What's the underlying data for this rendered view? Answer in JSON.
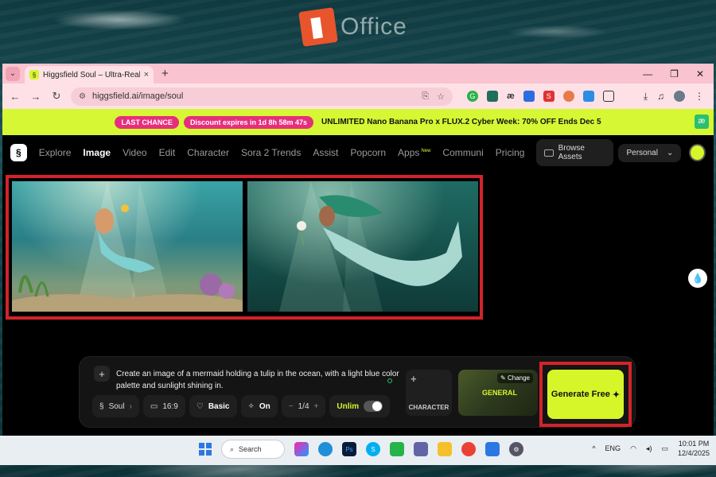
{
  "watermark": {
    "text": "Office"
  },
  "browser": {
    "tab_title": "Higgsfield Soul – Ultra-Realistic",
    "url": "higgsfield.ai/image/soul"
  },
  "promo": {
    "pill1": "LAST CHANCE",
    "pill2": "Discount expires in 1d 8h 58m 47s",
    "text": "UNLIMITED Nano Banana Pro x FLUX.2 Cyber Week: 70% OFF Ends Dec 5"
  },
  "nav": {
    "items": [
      "Explore",
      "Image",
      "Video",
      "Edit",
      "Character",
      "Sora 2 Trends",
      "Assist",
      "Popcorn",
      "Apps",
      "Communi",
      "Pricing"
    ],
    "apps_badge": "New",
    "browse_assets": "Browse Assets",
    "workspace": "Personal"
  },
  "composer": {
    "prompt": "Create an image of a mermaid holding a tulip in the ocean, with a light blue color palette and sunlight shining in.",
    "model": "Soul",
    "aspect": "16:9",
    "quality": "Basic",
    "enhance": "On",
    "count": "1/4",
    "unlim": "Unlim",
    "character_label": "CHARACTER",
    "style_change": "Change",
    "style_label": "GENERAL",
    "generate": "Generate Free"
  },
  "taskbar": {
    "search": "Search",
    "lang": "ENG",
    "time": "10:01 PM",
    "date": "12/4/2025"
  },
  "colors": {
    "accent": "#d7f62a",
    "highlight_border": "#d3232a",
    "promo_pink": "#e62f7c"
  }
}
